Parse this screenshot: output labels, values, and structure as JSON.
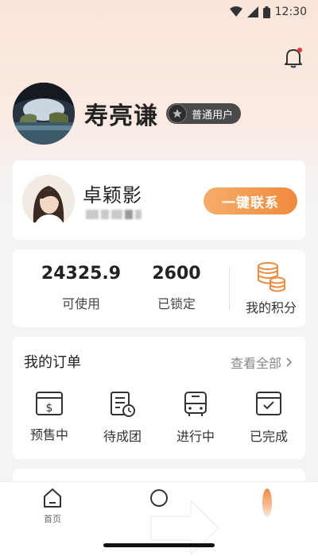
{
  "status_bar": {
    "time": "12:30"
  },
  "profile": {
    "name": "寿亮谦",
    "badge": "普通用户"
  },
  "agent": {
    "name": "卓颖影",
    "contact_label": "一键联系"
  },
  "stats": {
    "available_value": "24325.9",
    "available_label": "可使用",
    "locked_value": "2600",
    "locked_label": "已锁定",
    "points_label": "我的积分"
  },
  "orders": {
    "title": "我的订单",
    "view_all": "查看全部",
    "items": [
      {
        "label": "预售中",
        "icon": "presale-icon"
      },
      {
        "label": "待成团",
        "icon": "pending-group-icon"
      },
      {
        "label": "进行中",
        "icon": "bus-icon"
      },
      {
        "label": "已完成",
        "icon": "calendar-check-icon"
      }
    ]
  },
  "tabbar": {
    "home": "首页"
  },
  "colors": {
    "accent": "#f08a3c",
    "accent_light": "#f6ad6a",
    "badge_bg": "#4a4a4a"
  }
}
